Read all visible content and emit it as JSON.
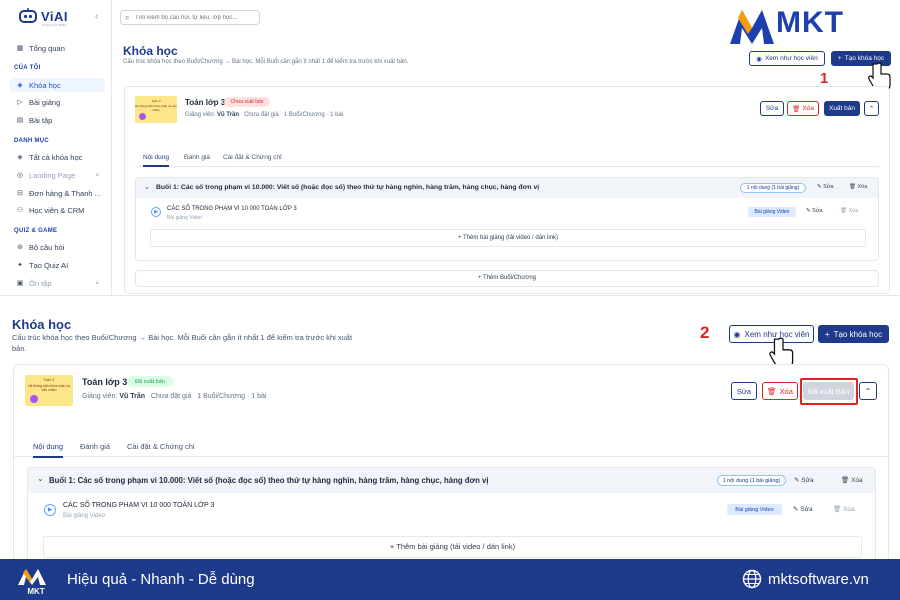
{
  "sidebar": {
    "logo_text": "ViAI",
    "logo_sub": "AI Agent for SMEs",
    "items_top": [
      {
        "label": "Tổng quan",
        "icon": "grid-icon"
      }
    ],
    "section_mine": "CỦA TÔI",
    "items_mine": [
      {
        "label": "Khóa học",
        "icon": "cap-icon",
        "active": true
      },
      {
        "label": "Bài giảng",
        "icon": "play-icon"
      },
      {
        "label": "Bài tập",
        "icon": "doc-icon"
      }
    ],
    "section_catalog": "DANH MỤC",
    "items_catalog": [
      {
        "label": "Tất cả khóa học",
        "icon": "cap-icon"
      },
      {
        "label": "Landing Page",
        "icon": "globe-icon",
        "disabled": true
      },
      {
        "label": "Đơn hàng & Thanh ...",
        "icon": "cart-icon"
      },
      {
        "label": "Học viên & CRM",
        "icon": "users-icon"
      }
    ],
    "section_quiz": "QUIZ & GAME",
    "items_quiz": [
      {
        "label": "Bộ câu hỏi",
        "icon": "question-icon"
      },
      {
        "label": "Tạo Quiz AI",
        "icon": "sparkle-icon"
      },
      {
        "label": "Ôn tập",
        "icon": "calendar-icon",
        "disabled": true
      }
    ]
  },
  "search": {
    "placeholder": "Tìm kiếm bộ câu hỏi, tự liệu, lớp học..."
  },
  "brand": {
    "name": "MKT"
  },
  "page": {
    "title": "Khóa học",
    "description": "Cấu trúc khóa học theo Buổi/Chương → Bài học. Mỗi Buổi cần gắn ít nhất 1 để kiểm tra trước khi xuất bản."
  },
  "buttons": {
    "view_as_student": "Xem như học viên",
    "create_course": "Tạo khóa học",
    "edit": "Sửa",
    "delete": "Xóa",
    "publish": "Xuất bản",
    "published": "Đã xuất Bản"
  },
  "steps": {
    "one": "1",
    "two": "2"
  },
  "course": {
    "thumb_title": "Toán 3",
    "thumb_subtitle": "Hệ thống kiến thức toán và văn chiều",
    "name": "Toán lớp 3",
    "status_draft": "Chưa xuất bản",
    "status_published": "Đã xuất bản",
    "instructor_label": "Giảng viên:",
    "instructor": "Vũ Trần",
    "price": "Chưa đặt giá",
    "stats": "1 Buổi/Chương · 1 bài"
  },
  "tabs": [
    "Nội dung",
    "Đánh giá",
    "Cài đặt & Chứng chỉ"
  ],
  "session": {
    "title": "Buổi 1: Các số trong phạm vi 10.000: Viết số (hoặc đọc số) theo thứ tự hàng nghìn, hàng trăm, hàng chục, hàng đơn vị",
    "count": "1 nội dung (1 bài giảng)",
    "edit": "Sửa",
    "delete": "Xóa"
  },
  "lesson": {
    "title": "CÁC SỐ TRONG PHẠM VI 10 000 TOÁN LỚP 3",
    "type": "Bài giảng Video",
    "badge": "Bài giảng Video",
    "edit": "Sửa",
    "delete": "Xóa"
  },
  "add_lesson": "+ Thêm bài giảng (tải video / dán link)",
  "add_session": "+ Thêm Buổi/Chương",
  "footer": {
    "slogan": "Hiệu quả - Nhanh - Dễ dùng",
    "website": "mktsoftware.vn"
  },
  "colors": {
    "primary": "#1e3a8a",
    "danger": "#dc2626",
    "success": "#16a34a",
    "footer_bg": "#1e3a8a"
  }
}
